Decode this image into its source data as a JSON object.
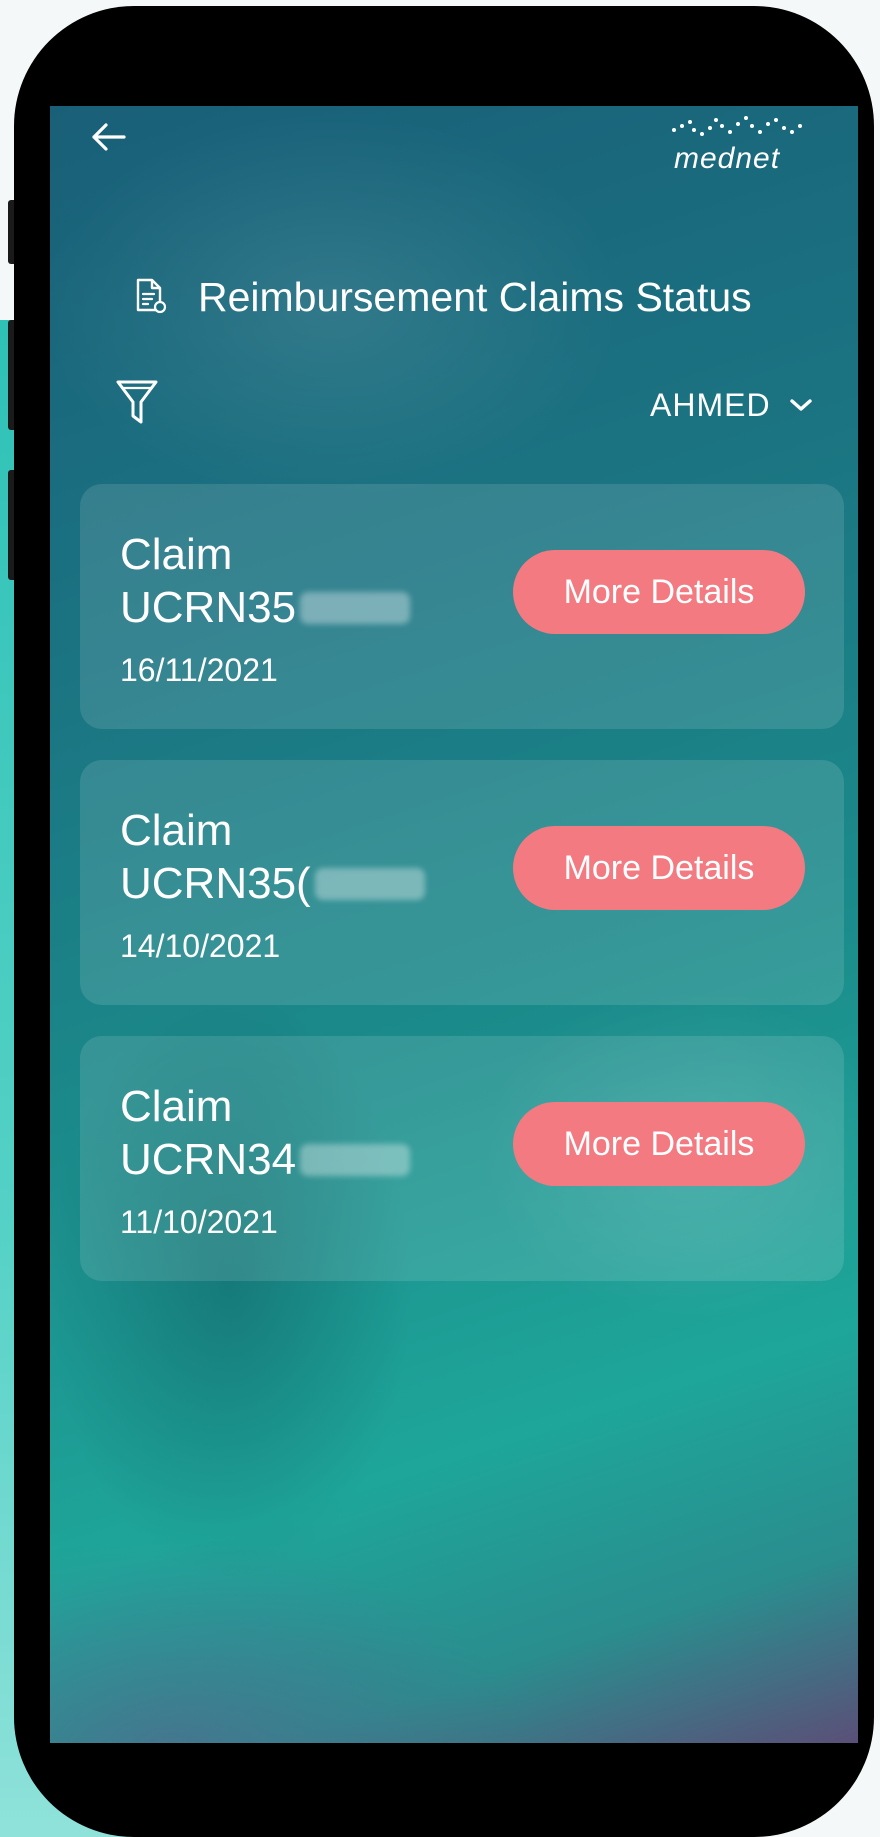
{
  "brand": {
    "logo_text": "mednet"
  },
  "header": {
    "title": "Reimbursement Claims Status"
  },
  "member_selector": {
    "selected": "AHMED"
  },
  "claims": [
    {
      "label": "Claim",
      "number": "UCRN35",
      "date": "16/11/2021",
      "button": "More Details"
    },
    {
      "label": "Claim",
      "number": "UCRN35(",
      "date": "14/10/2021",
      "button": "More Details"
    },
    {
      "label": "Claim",
      "number": "UCRN34",
      "date": "11/10/2021",
      "button": "More Details"
    }
  ],
  "colors": {
    "button": "#f37a80",
    "screen_top": "#195f78",
    "screen_bottom": "#1ea69a",
    "backdrop": "#2fc1b6"
  },
  "icons": {
    "back": "back-arrow-icon",
    "logo_mark": "logo-dots-icon",
    "title": "document-icon",
    "filter": "filter-icon",
    "dropdown": "chevron-down-icon"
  }
}
